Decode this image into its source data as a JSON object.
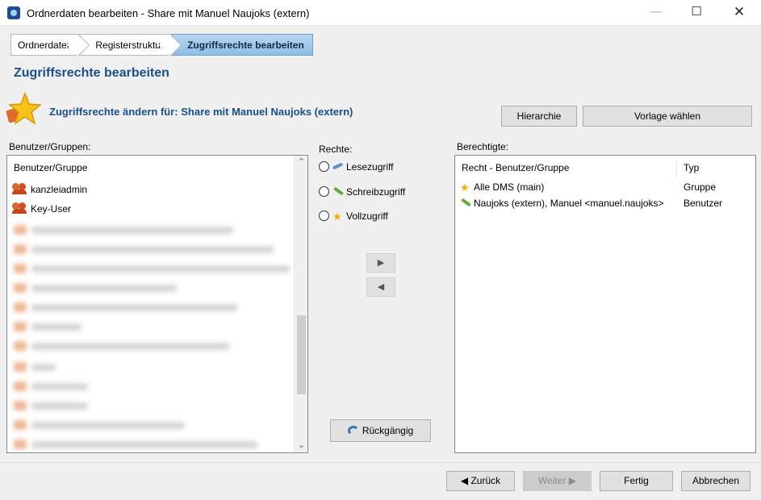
{
  "window": {
    "title": "Ordnerdaten bearbeiten - Share mit Manuel Naujoks (extern)",
    "minimize": "—",
    "maximize": "☐",
    "close": "✕"
  },
  "wizard": {
    "steps": [
      {
        "label": "Ordnerdaten"
      },
      {
        "label": "Registerstruktur"
      },
      {
        "label": "Zugriffsrechte bearbeiten",
        "active": true
      }
    ]
  },
  "page_title": "Zugriffsrechte bearbeiten",
  "subtitle": "Zugriffsrechte ändern für: Share mit Manuel Naujoks (extern)",
  "buttons": {
    "hierarchie": "Hierarchie",
    "vorlage": "Vorlage wählen",
    "move_right": "▶",
    "move_left": "◀",
    "undo": "Rückgängig",
    "back": "◀ Zurück",
    "next": "Weiter ▶",
    "finish": "Fertig",
    "cancel": "Abbrechen"
  },
  "users_panel": {
    "label": "Benutzer/Gruppen:",
    "column_header": "Benutzer/Gruppe",
    "visible_items": [
      "kanzleiadmin",
      "Key-User"
    ],
    "scroll_up": "⌃",
    "scroll_down": "⌄"
  },
  "rights_panel": {
    "label": "Rechte:",
    "options": [
      "Lesezugriff",
      "Schreibzugriff",
      "Vollzugriff"
    ]
  },
  "permitted_panel": {
    "label": "Berechtigte:",
    "columns": [
      "Recht - Benutzer/Gruppe",
      "Typ"
    ],
    "rows": [
      {
        "name": "Alle DMS (main)",
        "type": "Gruppe",
        "icon": "star-icon"
      },
      {
        "name": "Naujoks (extern), Manuel <manuel.naujoks>",
        "type": "Benutzer",
        "icon": "pencil-icon"
      }
    ]
  },
  "colors": {
    "accent_title": "#1a4f8c",
    "active_step": "#8ebee6"
  }
}
